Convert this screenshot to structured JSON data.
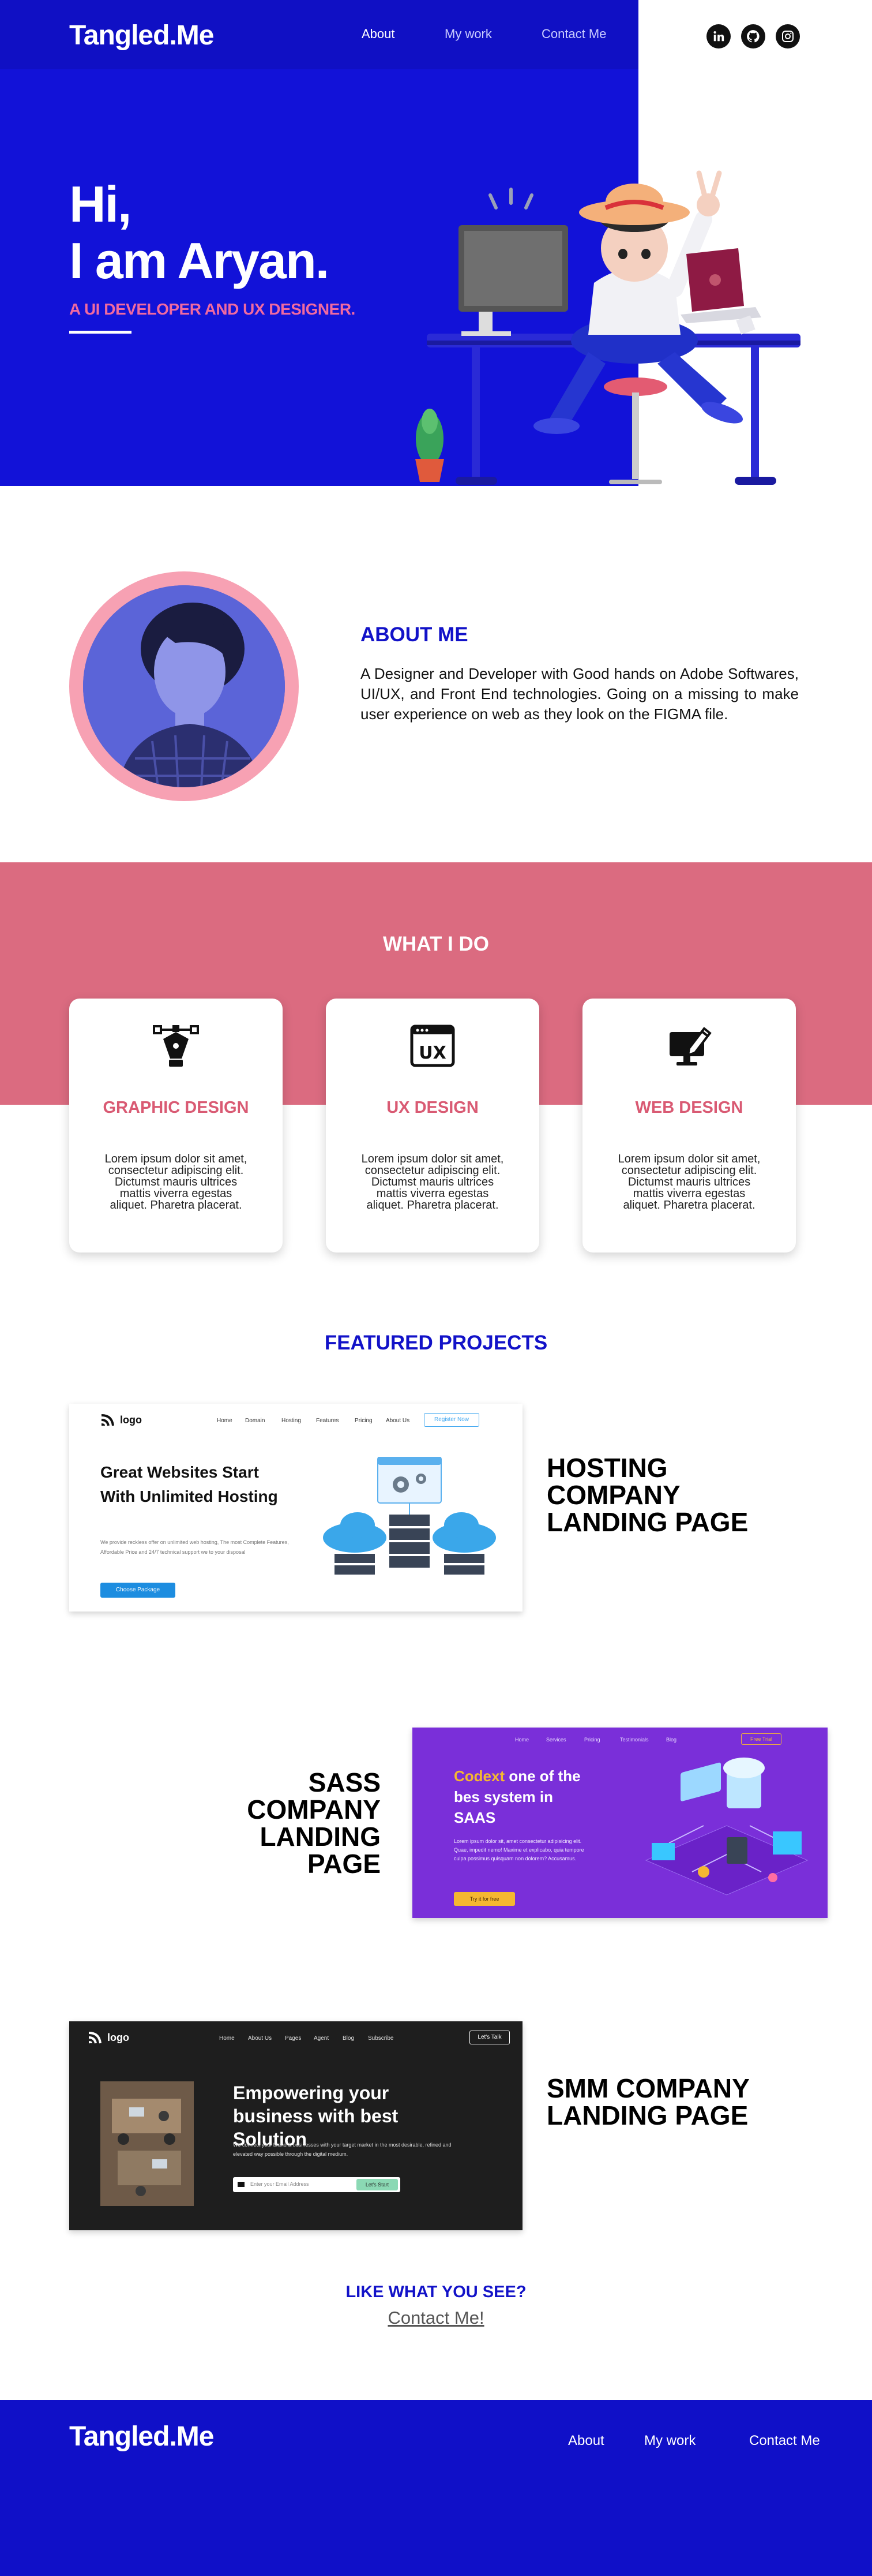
{
  "header": {
    "logo": "Tangled.Me",
    "nav": [
      "About",
      "My work",
      "Contact Me"
    ],
    "social": [
      "linkedin-icon",
      "github-icon",
      "instagram-icon"
    ]
  },
  "hero": {
    "greeting": "Hi,",
    "name": "I am Aryan.",
    "subtitle": "A UI DEVELOPER AND UX DESIGNER."
  },
  "about": {
    "title": "ABOUT ME",
    "text": "A Designer and Developer with Good hands on Adobe Softwares, UI/UX, and Front End technologies. Going on a missing to make user experience on web as they look on the FIGMA file."
  },
  "services": {
    "title": "WHAT I DO",
    "cards": [
      {
        "icon": "pen-tool-icon",
        "title": "GRAPHIC DESIGN",
        "text": "Lorem ipsum dolor sit amet, consectetur adipiscing elit. Dictumst mauris ultrices mattis viverra egestas aliquet. Pharetra placerat."
      },
      {
        "icon": "ux-window-icon",
        "title": "UX DESIGN",
        "text": "Lorem ipsum dolor sit amet, consectetur adipiscing elit. Dictumst mauris ultrices mattis viverra egestas aliquet. Pharetra placerat."
      },
      {
        "icon": "monitor-pen-icon",
        "title": "WEB DESIGN",
        "text": "Lorem ipsum dolor sit amet, consectetur adipiscing elit. Dictumst mauris ultrices mattis viverra egestas aliquet. Pharetra placerat."
      }
    ]
  },
  "projects": {
    "title": "FEATURED PROJECTS",
    "items": [
      {
        "title": "HOSTING COMPANY LANDING PAGE",
        "preview": {
          "logo": "logo",
          "nav": [
            "Home",
            "Domain",
            "Hosting",
            "Features",
            "Pricing",
            "About Us"
          ],
          "cta": "Register Now",
          "heading": "Great Websites Start With Unlimited Hosting",
          "body": "We provide reckless offer on unlimited web hosting, The most Complete Features, Affordable Price and 24/7 technical support we to your disposal",
          "button": "Choose Package"
        }
      },
      {
        "title": "SASS COMPANY LANDING PAGE",
        "preview": {
          "nav": [
            "Home",
            "Services",
            "Pricing",
            "Testimonials",
            "Blog"
          ],
          "cta": "Free Trial",
          "heading_accent": "Codext",
          "heading_rest": "one of the bes system in SAAS",
          "body": "Lorem ipsum dolor sit, amet consectetur adipisicing elit. Quae, impedit nemo! Maxime et explicabo, quia tempore culpa possimus quisquam non dolorem? Accusamus.",
          "button": "Try it for free"
        }
      },
      {
        "title": "SMM COMPANY LANDING PAGE",
        "preview": {
          "logo": "logo",
          "nav": [
            "Home",
            "About Us",
            "Pages",
            "Agent",
            "Blog",
            "Subscribe"
          ],
          "cta": "Let's Talk",
          "heading": "Empowering your business with best Solution",
          "body": "We connect your brand & businesses with your target market in the most desirable, refined and elevated way possible through the digital medium.",
          "placeholder": "Enter your Email Address",
          "button": "Let's Start"
        }
      }
    ]
  },
  "cta": {
    "title": "LIKE WHAT YOU SEE?",
    "link": "Contact Me!"
  },
  "footer": {
    "logo": "Tangled.Me",
    "nav": [
      "About",
      "My work",
      "Contact Me"
    ]
  },
  "colors": {
    "primary": "#1212d8",
    "pink": "#db6b80",
    "accent_pink": "#f06aa0",
    "footer": "#1010c8"
  }
}
